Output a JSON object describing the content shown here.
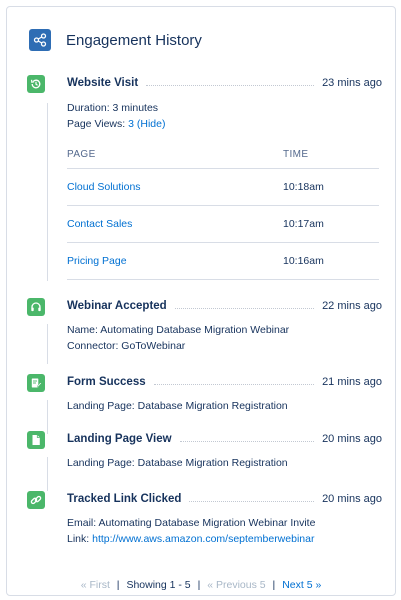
{
  "header": {
    "title": "Engagement History",
    "icon": "share-icon",
    "icon_color": "#2e6db4"
  },
  "accent_green": "#4bb76a",
  "items": [
    {
      "title": "Website Visit",
      "time": "23 mins ago",
      "icon": "clock-history-icon",
      "duration": "Duration: 3 minutes",
      "page_views_label": "Page Views:",
      "page_views_value": "3",
      "page_views_toggle": "(Hide)",
      "table": {
        "headers": [
          "PAGE",
          "TIME"
        ],
        "rows": [
          {
            "page": "Cloud Solutions",
            "time": "10:18am"
          },
          {
            "page": "Contact Sales",
            "time": "10:17am"
          },
          {
            "page": "Pricing Page",
            "time": "10:16am"
          }
        ]
      }
    },
    {
      "title": "Webinar Accepted",
      "time": "22 mins ago",
      "icon": "headset-icon",
      "line1": "Name: Automating Database Migration Webinar",
      "line2": "Connector: GoToWebinar"
    },
    {
      "title": "Form Success",
      "time": "21 mins ago",
      "icon": "form-edit-icon",
      "line1": "Landing Page: Database Migration Registration"
    },
    {
      "title": "Landing Page View",
      "time": "20 mins ago",
      "icon": "document-icon",
      "line1": "Landing Page: Database Migration Registration"
    },
    {
      "title": "Tracked Link Clicked",
      "time": "20 mins ago",
      "icon": "link-icon",
      "line1": "Email: Automating Database Migration Webinar Invite",
      "line2_label": "Link:",
      "line2_link": "http://www.aws.amazon.com/septemberwebinar"
    }
  ],
  "pager": {
    "first": "« First",
    "showing": "Showing 1 - 5",
    "previous": "« Previous 5",
    "next": "Next 5 »"
  }
}
